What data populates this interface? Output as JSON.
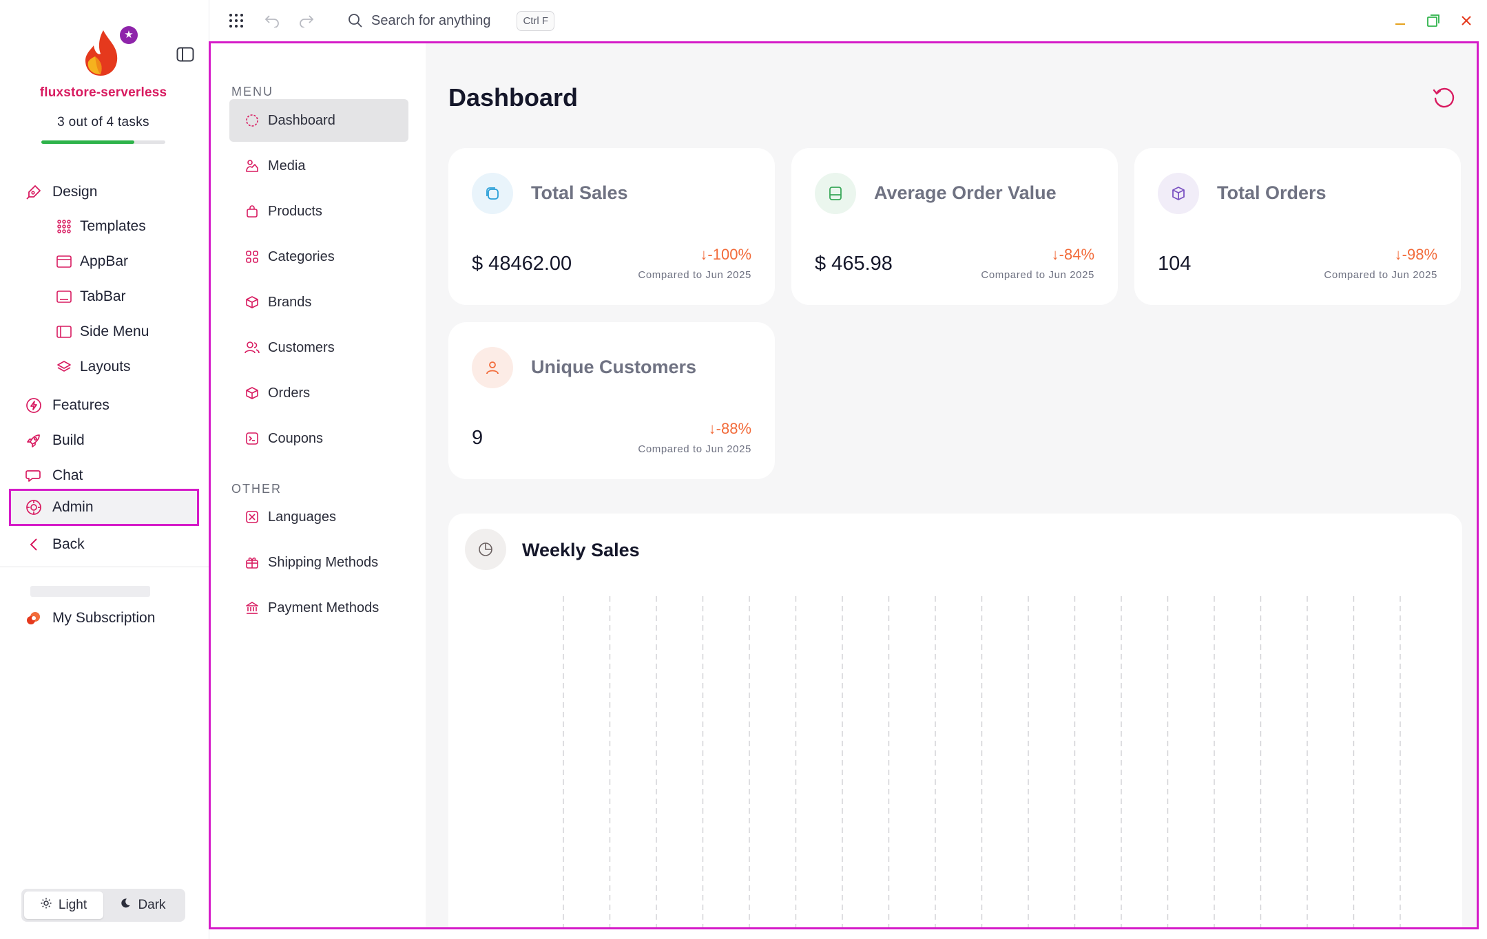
{
  "project": {
    "name": "fluxstore-serverless",
    "tasks_text": "3 out of 4 tasks",
    "tasks_done": 3,
    "tasks_total": 4
  },
  "sidebar": {
    "design": "Design",
    "templates": "Templates",
    "appbar": "AppBar",
    "tabbar": "TabBar",
    "side_menu": "Side Menu",
    "layouts": "Layouts",
    "features": "Features",
    "build": "Build",
    "chat": "Chat",
    "admin": "Admin",
    "back": "Back",
    "subscription": "My Subscription"
  },
  "theme": {
    "light": "Light",
    "dark": "Dark",
    "selected": "Light"
  },
  "topbar": {
    "search_placeholder": "Search for anything",
    "shortcut": "Ctrl F"
  },
  "menu": {
    "section_menu": "MENU",
    "section_other": "OTHER",
    "items": [
      "Dashboard",
      "Media",
      "Products",
      "Categories",
      "Brands",
      "Customers",
      "Orders",
      "Coupons"
    ],
    "other_items": [
      "Languages",
      "Shipping Methods",
      "Payment Methods"
    ],
    "active": "Dashboard"
  },
  "dashboard": {
    "title": "Dashboard",
    "cards": [
      {
        "title": "Total Sales",
        "value": "$ 48462.00",
        "delta": "-100%",
        "compare": "Compared to Jun 2025"
      },
      {
        "title": "Average Order Value",
        "value": "$ 465.98",
        "delta": "-84%",
        "compare": "Compared to Jun 2025"
      },
      {
        "title": "Total Orders",
        "value": "104",
        "delta": "-98%",
        "compare": "Compared to Jun 2025"
      },
      {
        "title": "Unique Customers",
        "value": "9",
        "delta": "-88%",
        "compare": "Compared to Jun 2025"
      }
    ],
    "weekly_title": "Weekly Sales"
  },
  "colors": {
    "accent": "#d81b60",
    "highlight": "#d51bc8",
    "progress": "#2eb34a",
    "negative": "#f26b3a"
  },
  "chart_data": {
    "type": "bar",
    "title": "Weekly Sales",
    "gridlines": 19,
    "grid": true
  }
}
